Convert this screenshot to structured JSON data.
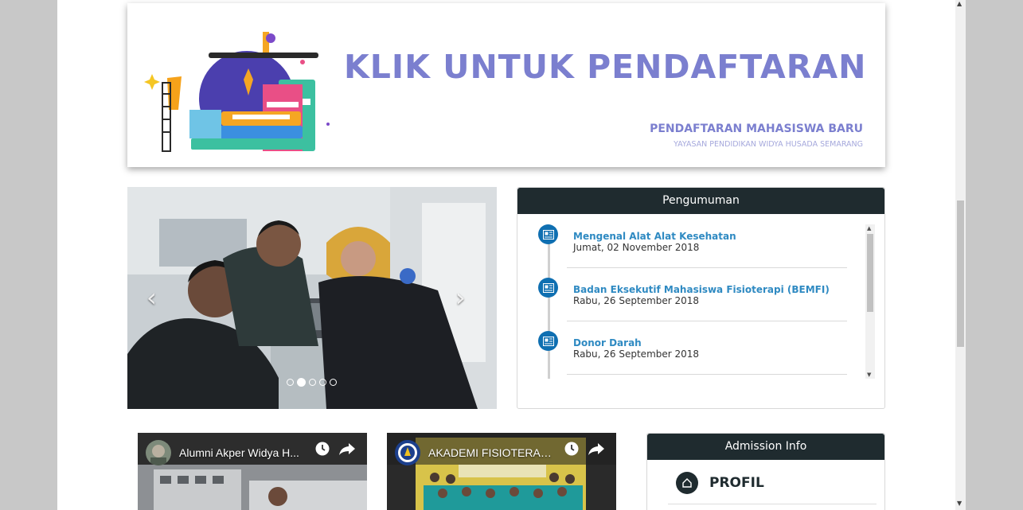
{
  "banner": {
    "title": "KLIK UNTUK PENDAFTARAN",
    "subtitle": "PENDAFTARAN MAHASISWA BARU",
    "foundation": "YAYASAN PENDIDIKAN WIDYA HUSADA SEMARANG",
    "accent_color": "#7b7fcf"
  },
  "carousel": {
    "prev_icon": "chevron-left-icon",
    "next_icon": "chevron-right-icon",
    "prev_label": "‹",
    "next_label": "›",
    "slide_count": 5,
    "active_slide": 2
  },
  "announcements": {
    "heading": "Pengumuman",
    "items": [
      {
        "title": "Mengenal Alat Alat Kesehatan",
        "date": "Jumat, 02 November 2018",
        "icon": "newspaper-icon"
      },
      {
        "title": "Badan Eksekutif Mahasiswa Fisioterapi (BEMFI)",
        "date": "Rabu, 26 September 2018",
        "icon": "newspaper-icon"
      },
      {
        "title": "Donor Darah",
        "date": "Rabu, 26 September 2018",
        "icon": "newspaper-icon"
      }
    ],
    "icon_color": "#0f6fb1",
    "link_color": "#2f8ac2"
  },
  "admission": {
    "heading": "Admission Info",
    "items": [
      {
        "label": "PROFIL",
        "icon": "home-icon"
      }
    ]
  },
  "videos": [
    {
      "title": "Alumni Akper Widya H...",
      "icons": [
        "clock-icon",
        "share-icon"
      ]
    },
    {
      "title": "AKADEMI FISIOTERAPI...",
      "icons": [
        "clock-icon",
        "share-icon"
      ]
    }
  ],
  "colors": {
    "panel_header_bg": "#1f2b2f",
    "page_bg": "#c8c8c8"
  }
}
